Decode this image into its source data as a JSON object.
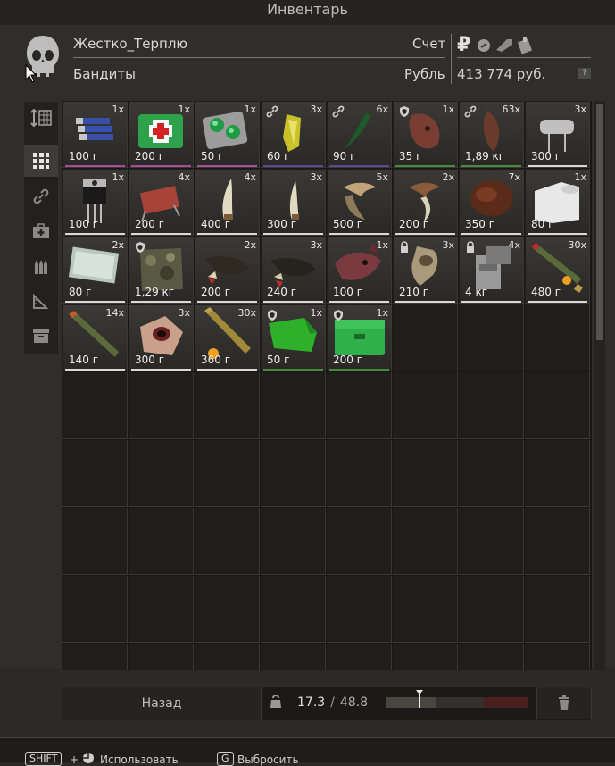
{
  "window": {
    "title": "Инвентарь"
  },
  "trader": {
    "name": "Жестко_Терплю",
    "faction": "Бандиты"
  },
  "account": {
    "label": "Счет",
    "currency_label": "Рубль",
    "balance": "413 774 руб.",
    "help": "?"
  },
  "currency_icons": [
    "ruble-icon",
    "coin-icon",
    "key-card-icon",
    "item-badge-icon"
  ],
  "items": [
    {
      "name": "batteries",
      "count": "1x",
      "price": "100 г",
      "row": 0,
      "col": 0,
      "color": "#a54f9b",
      "mark": ""
    },
    {
      "name": "medkit",
      "count": "1x",
      "price": "200 г",
      "row": 0,
      "col": 1,
      "color": "#a54f9b",
      "mark": ""
    },
    {
      "name": "green-pills",
      "count": "1x",
      "price": "50 г",
      "row": 0,
      "col": 2,
      "color": "#a54f9b",
      "mark": ""
    },
    {
      "name": "yellow-crystal",
      "count": "3x",
      "price": "60 г",
      "row": 0,
      "col": 3,
      "color": "#5a4b8f",
      "mark": "link"
    },
    {
      "name": "green-claw",
      "count": "6x",
      "price": "90 г",
      "row": 0,
      "col": 4,
      "color": "#5a4b8f",
      "mark": "link"
    },
    {
      "name": "dog-head",
      "count": "1x",
      "price": "35 г",
      "row": 0,
      "col": 5,
      "color": "#4c8a3f",
      "mark": "shield"
    },
    {
      "name": "tail",
      "count": "63x",
      "price": "1,89 кг",
      "row": 0,
      "col": 6,
      "color": "#4c8a3f",
      "mark": "link"
    },
    {
      "name": "capacitor",
      "count": "3x",
      "price": "300 г",
      "row": 0,
      "col": 7,
      "color": "#d9d9d9",
      "mark": ""
    },
    {
      "name": "transistor",
      "count": "1x",
      "price": "100 г",
      "row": 1,
      "col": 0,
      "color": "#d9d9d9",
      "mark": ""
    },
    {
      "name": "resistor",
      "count": "4x",
      "price": "200 г",
      "row": 1,
      "col": 1,
      "color": "#d9d9d9",
      "mark": ""
    },
    {
      "name": "fang",
      "count": "4x",
      "price": "400 г",
      "row": 1,
      "col": 2,
      "color": "#d9d9d9",
      "mark": ""
    },
    {
      "name": "fang-small",
      "count": "3x",
      "price": "300 г",
      "row": 1,
      "col": 3,
      "color": "#d9d9d9",
      "mark": ""
    },
    {
      "name": "claw",
      "count": "5x",
      "price": "500 г",
      "row": 1,
      "col": 4,
      "color": "#d9d9d9",
      "mark": ""
    },
    {
      "name": "claw-dark",
      "count": "2x",
      "price": "200 г",
      "row": 1,
      "col": 5,
      "color": "#d9d9d9",
      "mark": ""
    },
    {
      "name": "fur",
      "count": "7x",
      "price": "350 г",
      "row": 1,
      "col": 6,
      "color": "#d9d9d9",
      "mark": ""
    },
    {
      "name": "toilet-paper",
      "count": "1x",
      "price": "80 г",
      "row": 1,
      "col": 7,
      "color": "#d9d9d9",
      "mark": ""
    },
    {
      "name": "money-stack",
      "count": "2x",
      "price": "80 г",
      "row": 2,
      "col": 0,
      "color": "#d9d9d9",
      "mark": ""
    },
    {
      "name": "camo-vest",
      "count": "",
      "price": "1,29 кг",
      "row": 2,
      "col": 1,
      "color": "#d9d9d9",
      "mark": "shield"
    },
    {
      "name": "boar-tusk",
      "count": "2x",
      "price": "200 г",
      "row": 2,
      "col": 2,
      "color": "#d9d9d9",
      "mark": ""
    },
    {
      "name": "boar-tusk-dark",
      "count": "3x",
      "price": "240 г",
      "row": 2,
      "col": 3,
      "color": "#d9d9d9",
      "mark": ""
    },
    {
      "name": "rat-head",
      "count": "1x",
      "price": "100 г",
      "row": 2,
      "col": 4,
      "color": "#d9d9d9",
      "mark": ""
    },
    {
      "name": "bone",
      "count": "3x",
      "price": "210 г",
      "row": 2,
      "col": 5,
      "color": "#d9d9d9",
      "mark": "lock"
    },
    {
      "name": "metal-box",
      "count": "4x",
      "price": "4 кг",
      "row": 2,
      "col": 6,
      "color": "#d9d9d9",
      "mark": "lock"
    },
    {
      "name": "cartridge-red",
      "count": "30x",
      "price": "480 г",
      "row": 2,
      "col": 7,
      "color": "#d9d9d9",
      "mark": ""
    },
    {
      "name": "cartridge-green",
      "count": "14x",
      "price": "140 г",
      "row": 3,
      "col": 0,
      "color": "#d9d9d9",
      "mark": ""
    },
    {
      "name": "eye-flesh",
      "count": "3x",
      "price": "300 г",
      "row": 3,
      "col": 1,
      "color": "#d9d9d9",
      "mark": ""
    },
    {
      "name": "cartridge-brass",
      "count": "30x",
      "price": "360 г",
      "row": 3,
      "col": 2,
      "color": "#d9d9d9",
      "mark": ""
    },
    {
      "name": "green-cloth",
      "count": "1x",
      "price": "50 г",
      "row": 3,
      "col": 3,
      "color": "#4c8a3f",
      "mark": "shield"
    },
    {
      "name": "green-case",
      "count": "1x",
      "price": "200 г",
      "row": 3,
      "col": 4,
      "color": "#4c8a3f",
      "mark": "shield"
    }
  ],
  "footer_bar": {
    "back_label": "Назад",
    "weight_current": "17.3",
    "weight_sep": "/",
    "weight_max": "48.8",
    "weight_fraction": 0.354
  },
  "hotkeys": [
    {
      "key": "SHIFT",
      "plus": "+",
      "label": "Использовать"
    },
    {
      "key": "G",
      "label": "Выбросить"
    }
  ]
}
